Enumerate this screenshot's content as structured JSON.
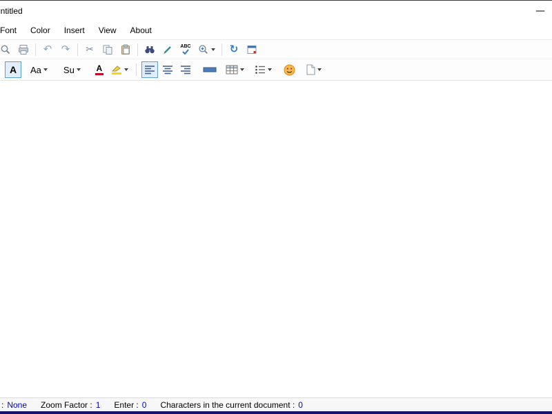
{
  "window": {
    "title": "Untitled",
    "minimize_glyph": "—"
  },
  "menu": {
    "items": [
      {
        "label": "Font"
      },
      {
        "label": "Color"
      },
      {
        "label": "Insert"
      },
      {
        "label": "View"
      },
      {
        "label": "About"
      }
    ]
  },
  "toolbar_main": {
    "spell_label": "ABC",
    "icons": [
      "print-preview",
      "print",
      "undo",
      "redo",
      "cut",
      "copy",
      "paste",
      "find",
      "edit-pen",
      "spell-check",
      "zoom",
      "refresh",
      "date-time"
    ]
  },
  "toolbar_format": {
    "font_toggle_label": "A",
    "case_label": "Aa",
    "script_label": "Su",
    "font_color_label": "A",
    "icons": [
      "font-toggle",
      "change-case",
      "superscript",
      "font-color",
      "highlight",
      "align-left",
      "align-center",
      "align-right",
      "horizontal-line",
      "table",
      "list",
      "emoji",
      "page"
    ]
  },
  "statusbar": {
    "items": [
      {
        "label": ":",
        "value": "None"
      },
      {
        "label": "Zoom Factor :",
        "value": "1"
      },
      {
        "label": "Enter :",
        "value": "0"
      },
      {
        "label": "Characters in the current document :",
        "value": "0"
      }
    ]
  },
  "colors": {
    "selected_border": "#5a9fd4",
    "selected_bg": "#e1eef9",
    "value_text": "#0000cc",
    "bottom_strip": "#14146a",
    "accent_blue": "#2f7cc4"
  }
}
